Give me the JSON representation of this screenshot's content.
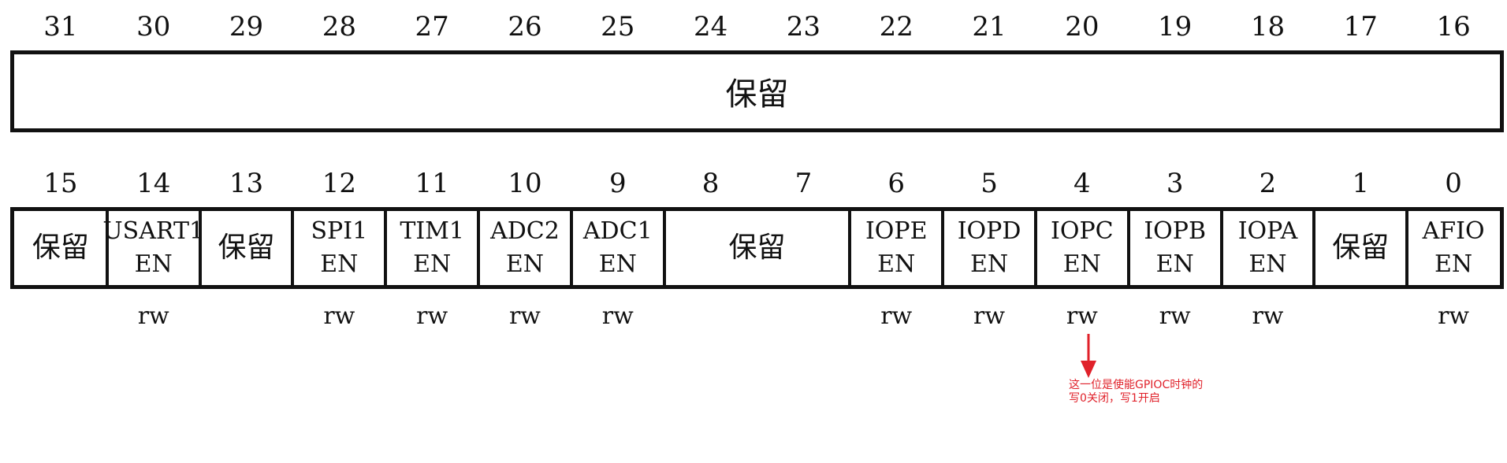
{
  "top_row": {
    "bit_numbers": [
      "31",
      "30",
      "29",
      "28",
      "27",
      "26",
      "25",
      "24",
      "23",
      "22",
      "21",
      "20",
      "19",
      "18",
      "17",
      "16"
    ],
    "reserved_label": "保留"
  },
  "bottom_row": {
    "bit_numbers": [
      "15",
      "14",
      "13",
      "12",
      "11",
      "10",
      "9",
      "8",
      "7",
      "6",
      "5",
      "4",
      "3",
      "2",
      "1",
      "0"
    ],
    "fields": [
      {
        "line1": "保留",
        "line2": "",
        "access": "",
        "reserved": true
      },
      {
        "line1": "USART1",
        "line2": "EN",
        "access": "rw",
        "reserved": false
      },
      {
        "line1": "保留",
        "line2": "",
        "access": "",
        "reserved": true
      },
      {
        "line1": "SPI1",
        "line2": "EN",
        "access": "rw",
        "reserved": false
      },
      {
        "line1": "TIM1",
        "line2": "EN",
        "access": "rw",
        "reserved": false
      },
      {
        "line1": "ADC2",
        "line2": "EN",
        "access": "rw",
        "reserved": false
      },
      {
        "line1": "ADC1",
        "line2": "EN",
        "access": "rw",
        "reserved": false
      },
      {
        "line1": "保留",
        "line2": "",
        "access": "",
        "reserved": true
      },
      {
        "line1": "IOPE",
        "line2": "EN",
        "access": "rw",
        "reserved": false
      },
      {
        "line1": "IOPD",
        "line2": "EN",
        "access": "rw",
        "reserved": false
      },
      {
        "line1": "IOPC",
        "line2": "EN",
        "access": "rw",
        "reserved": false
      },
      {
        "line1": "IOPB",
        "line2": "EN",
        "access": "rw",
        "reserved": false
      },
      {
        "line1": "IOPA",
        "line2": "EN",
        "access": "rw",
        "reserved": false
      },
      {
        "line1": "保留",
        "line2": "",
        "access": "",
        "reserved": true
      },
      {
        "line1": "AFIO",
        "line2": "EN",
        "access": "rw",
        "reserved": false
      }
    ]
  },
  "annotation": {
    "line1": "这一位是使能GPIOC时钟的",
    "line2": "写0关闭，写1开启",
    "color": "#e0212a"
  }
}
